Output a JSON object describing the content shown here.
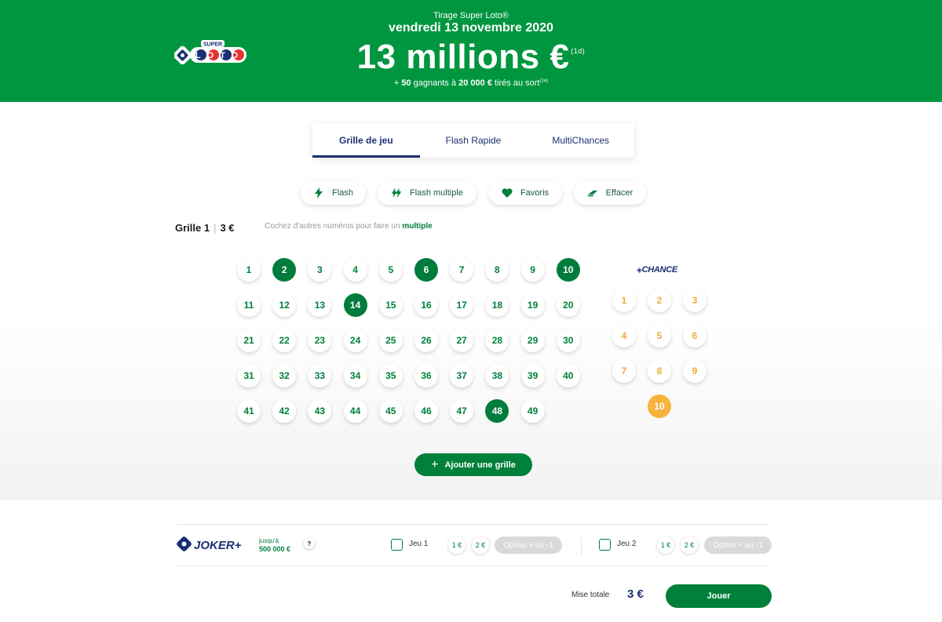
{
  "header": {
    "draw_label": "Tirage Super Loto®",
    "draw_date": "vendredi 13 novembre 2020",
    "jackpot": "13 millions €",
    "jackpot_note": "(1d)",
    "winners_prefix": "+ ",
    "winners_count": "50",
    "winners_mid": " gagnants à ",
    "winners_amount": "20 000 €",
    "winners_suffix": " tirés au sort",
    "winners_note": "(1e)",
    "logo_super": "SUPER",
    "logo_loto": "LOTO"
  },
  "tabs": [
    {
      "label": "Grille de jeu",
      "active": true
    },
    {
      "label": "Flash Rapide",
      "active": false
    },
    {
      "label": "MultiChances",
      "active": false
    }
  ],
  "tools": {
    "flash": "Flash",
    "flash_multiple": "Flash multiple",
    "favorites": "Favoris",
    "clear": "Effacer"
  },
  "grid": {
    "title": "Grille 1",
    "price": "3 €",
    "hint_prefix": "Cochez d'autres numéros pour faire un ",
    "hint_link": "multiple",
    "numbers": [
      1,
      2,
      3,
      4,
      5,
      6,
      7,
      8,
      9,
      10,
      11,
      12,
      13,
      14,
      15,
      16,
      17,
      18,
      19,
      20,
      21,
      22,
      23,
      24,
      25,
      26,
      27,
      28,
      29,
      30,
      31,
      32,
      33,
      34,
      35,
      36,
      37,
      38,
      39,
      40,
      41,
      42,
      43,
      44,
      45,
      46,
      47,
      48,
      49
    ],
    "selected": [
      2,
      6,
      10,
      14,
      48
    ],
    "chance_label": "CHANCE",
    "chance_numbers": [
      1,
      2,
      3,
      4,
      5,
      6,
      7,
      8,
      9,
      10
    ],
    "chance_selected": [
      10
    ],
    "add_grid": "Ajouter une grille"
  },
  "joker": {
    "logo": "JOKER+",
    "upto_label": "jusqu'à",
    "upto_amount": "500 000 €",
    "help": "?",
    "game1": "Jeu 1",
    "game2": "Jeu 2",
    "price1": "1 €",
    "price2": "2 €",
    "option": "Option + ou -1"
  },
  "footer": {
    "total_label": "Mise totale",
    "total_value": "3 €",
    "play": "Jouer"
  },
  "colors": {
    "header_green": "#00963f",
    "ball_green": "#007c3c",
    "chance_orange": "#f7b33f",
    "navy": "#1b2f73"
  }
}
